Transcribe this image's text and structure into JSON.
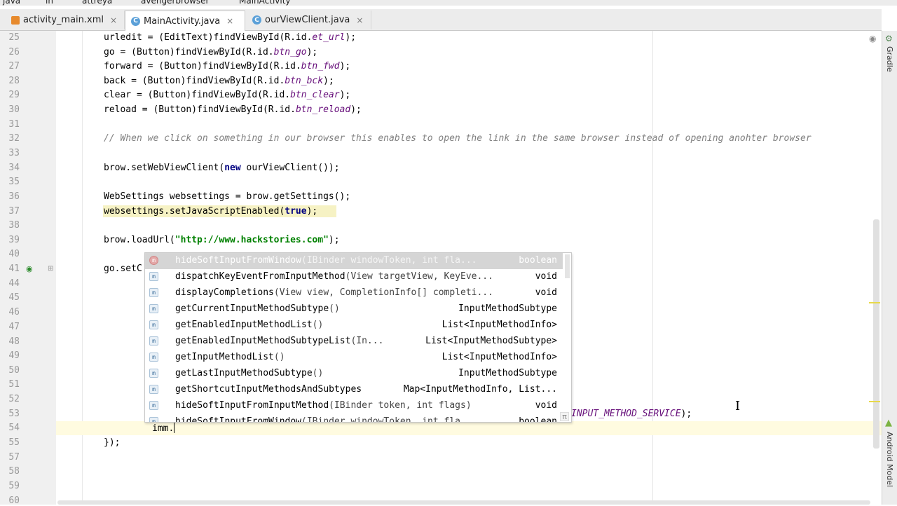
{
  "breadcrumb": [
    "java",
    "in",
    "attreya",
    "avengerbrowser",
    "MainActivity"
  ],
  "tabs": [
    {
      "label": "activity_main.xml",
      "icon": "xml-file-icon",
      "active": false
    },
    {
      "label": "MainActivity.java",
      "icon": "class-c-icon",
      "active": true
    },
    {
      "label": "ourViewClient.java",
      "icon": "class-c-icon",
      "active": false
    }
  ],
  "tab_close": "×",
  "class_icon_letter": "C",
  "line_numbers": [
    "25",
    "26",
    "27",
    "28",
    "29",
    "30",
    "31",
    "32",
    "33",
    "34",
    "35",
    "36",
    "37",
    "38",
    "39",
    "40",
    "41",
    "44",
    "45",
    "46",
    "47",
    "48",
    "49",
    "50",
    "51",
    "52",
    "53",
    "54",
    "55",
    "57",
    "58",
    "59",
    "60"
  ],
  "code": {
    "l25": {
      "a": "urledit = (EditText)findViewById(R.id.",
      "f": "et_url",
      "b": ");"
    },
    "l26": {
      "a": "go = (Button)findViewById(R.id.",
      "f": "btn_go",
      "b": ");"
    },
    "l27": {
      "a": "forward = (Button)findViewById(R.id.",
      "f": "btn_fwd",
      "b": ");"
    },
    "l28": {
      "a": "back = (Button)findViewById(R.id.",
      "f": "btn_bck",
      "b": ");"
    },
    "l29": {
      "a": "clear = (Button)findViewById(R.id.",
      "f": "btn_clear",
      "b": ");"
    },
    "l30": {
      "a": "reload = (Button)findViewById(R.id.",
      "f": "btn_reload",
      "b": ");"
    },
    "l32": "// When we click on something in our browser this enables to open the link in the same browser instead of opening anohter browser",
    "l34": {
      "a": "brow.setWebViewClient(",
      "kw": "new",
      "b": " ourViewClient());"
    },
    "l36": "WebSettings websettings = brow.getSettings();",
    "l37": {
      "a": "websettings.setJavaScriptEnabled(",
      "kw": "true",
      "b": ");"
    },
    "l39": {
      "a": "brow.loadUrl(",
      "s": "\"http://www.hackstories.com\"",
      "b": ");"
    },
    "l41": "go.setC",
    "l53_tail": {
      "f": "INPUT_METHOD_SERVICE",
      "b": ");"
    },
    "l54": "imm.",
    "l55": "});"
  },
  "autocomplete": [
    {
      "name": "hideSoftInputFromWindow",
      "params": "(IBinder windowToken, int fla...",
      "type": "boolean",
      "icon": "m",
      "selected": true
    },
    {
      "name": "dispatchKeyEventFromInputMethod",
      "params": "(View targetView, KeyEve...",
      "type": "void",
      "icon": "m"
    },
    {
      "name": "displayCompletions",
      "params": "(View view, CompletionInfo[] completi...",
      "type": "void",
      "icon": "m"
    },
    {
      "name": "getCurrentInputMethodSubtype",
      "params": "()",
      "type": "InputMethodSubtype",
      "icon": "m"
    },
    {
      "name": "getEnabledInputMethodList",
      "params": "()",
      "type": "List<InputMethodInfo>",
      "icon": "m"
    },
    {
      "name": "getEnabledInputMethodSubtypeList",
      "params": "(In...",
      "type": "List<InputMethodSubtype>",
      "icon": "m"
    },
    {
      "name": "getInputMethodList",
      "params": "()",
      "type": "List<InputMethodInfo>",
      "icon": "m"
    },
    {
      "name": "getLastInputMethodSubtype",
      "params": "()",
      "type": "InputMethodSubtype",
      "icon": "m"
    },
    {
      "name": "getShortcutInputMethodsAndSubtypes",
      "params": "",
      "type": "Map<InputMethodInfo, List...",
      "icon": "m"
    },
    {
      "name": "hideSoftInputFromInputMethod",
      "params": "(IBinder token, int flags)",
      "type": "void",
      "icon": "m"
    },
    {
      "name": "hideSoftInputFromWindow",
      "params": "(IBinder windowToken, int fla...",
      "type": "boolean",
      "icon": "m"
    }
  ],
  "pi_symbol": "π",
  "right_panel": {
    "gradle": "Gradle",
    "android_model": "Android Model"
  },
  "colors": {
    "keyword": "#000080",
    "string": "#008000",
    "field": "#660e7a",
    "comment": "#808080",
    "warning_bg": "#f6f2c4"
  }
}
